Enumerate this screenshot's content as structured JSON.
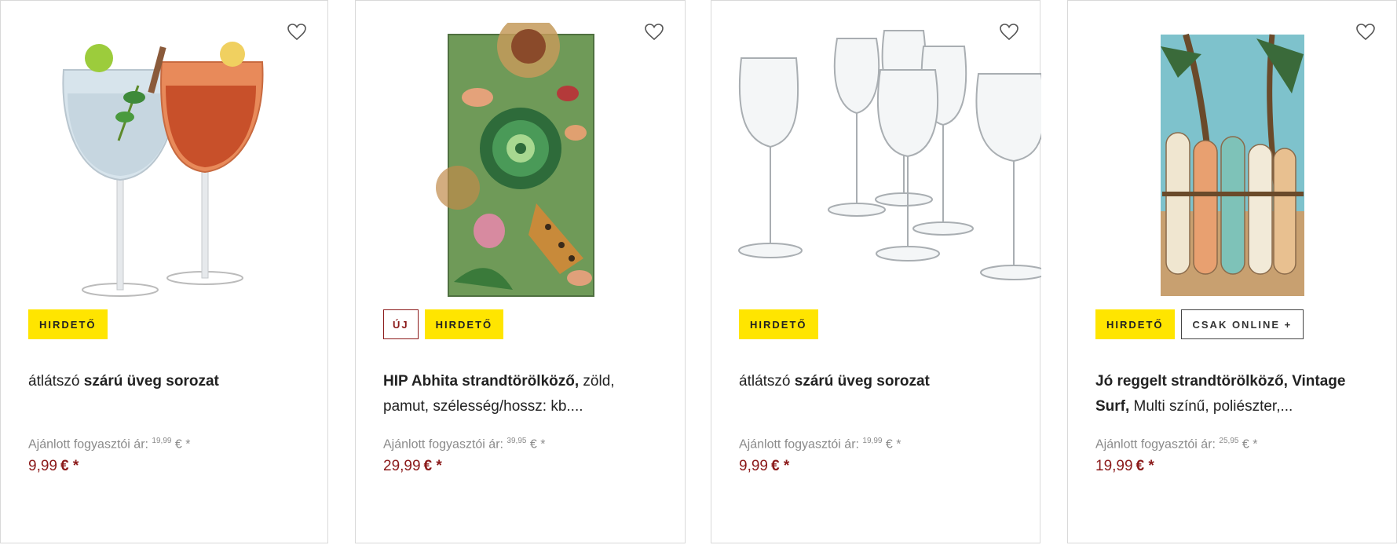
{
  "products": [
    {
      "badges": {
        "hirdeto": "HIRDETŐ"
      },
      "title_normal_1": "átlátszó ",
      "title_bold": "szárú üveg sorozat",
      "title_normal_2": "",
      "rrp_label": "Ajánlott fogyasztói ár:",
      "rrp_value": "19,99",
      "rrp_suffix": "€ *",
      "price": "9,99",
      "price_suffix": "€ *",
      "image": "gin-tonic-glasses"
    },
    {
      "badges": {
        "new": "ÚJ",
        "hirdeto": "HIRDETŐ"
      },
      "title_normal_1": "",
      "title_bold": "HIP Abhita strandtörölköző,",
      "title_normal_2": " zöld, pamut, szélesség/hossz: kb....",
      "rrp_label": "Ajánlott fogyasztói ár:",
      "rrp_value": "39,95",
      "rrp_suffix": "€ *",
      "price": "29,99",
      "price_suffix": "€ *",
      "image": "jungle-beach-towel"
    },
    {
      "badges": {
        "hirdeto": "HIRDETŐ"
      },
      "title_normal_1": "átlátszó ",
      "title_bold": "szárú üveg sorozat",
      "title_normal_2": "",
      "rrp_label": "Ajánlott fogyasztói ár:",
      "rrp_value": "19,99",
      "rrp_suffix": "€ *",
      "price": "9,99",
      "price_suffix": "€ *",
      "image": "wine-glass-set"
    },
    {
      "badges": {
        "hirdeto": "HIRDETŐ",
        "online": "CSAK ONLINE +"
      },
      "title_normal_1": "",
      "title_bold": "Jó reggelt strandtörölköző, Vintage Surf,",
      "title_normal_2": " Multi színű, poliészter,...",
      "rrp_label": "Ajánlott fogyasztói ár:",
      "rrp_value": "25,95",
      "rrp_suffix": "€ *",
      "price": "19,99",
      "price_suffix": "€ *",
      "image": "surf-beach-towel"
    }
  ],
  "colors": {
    "badge_yellow": "#ffe500",
    "price_red": "#8b1a1a",
    "muted": "#8a8a8a"
  }
}
